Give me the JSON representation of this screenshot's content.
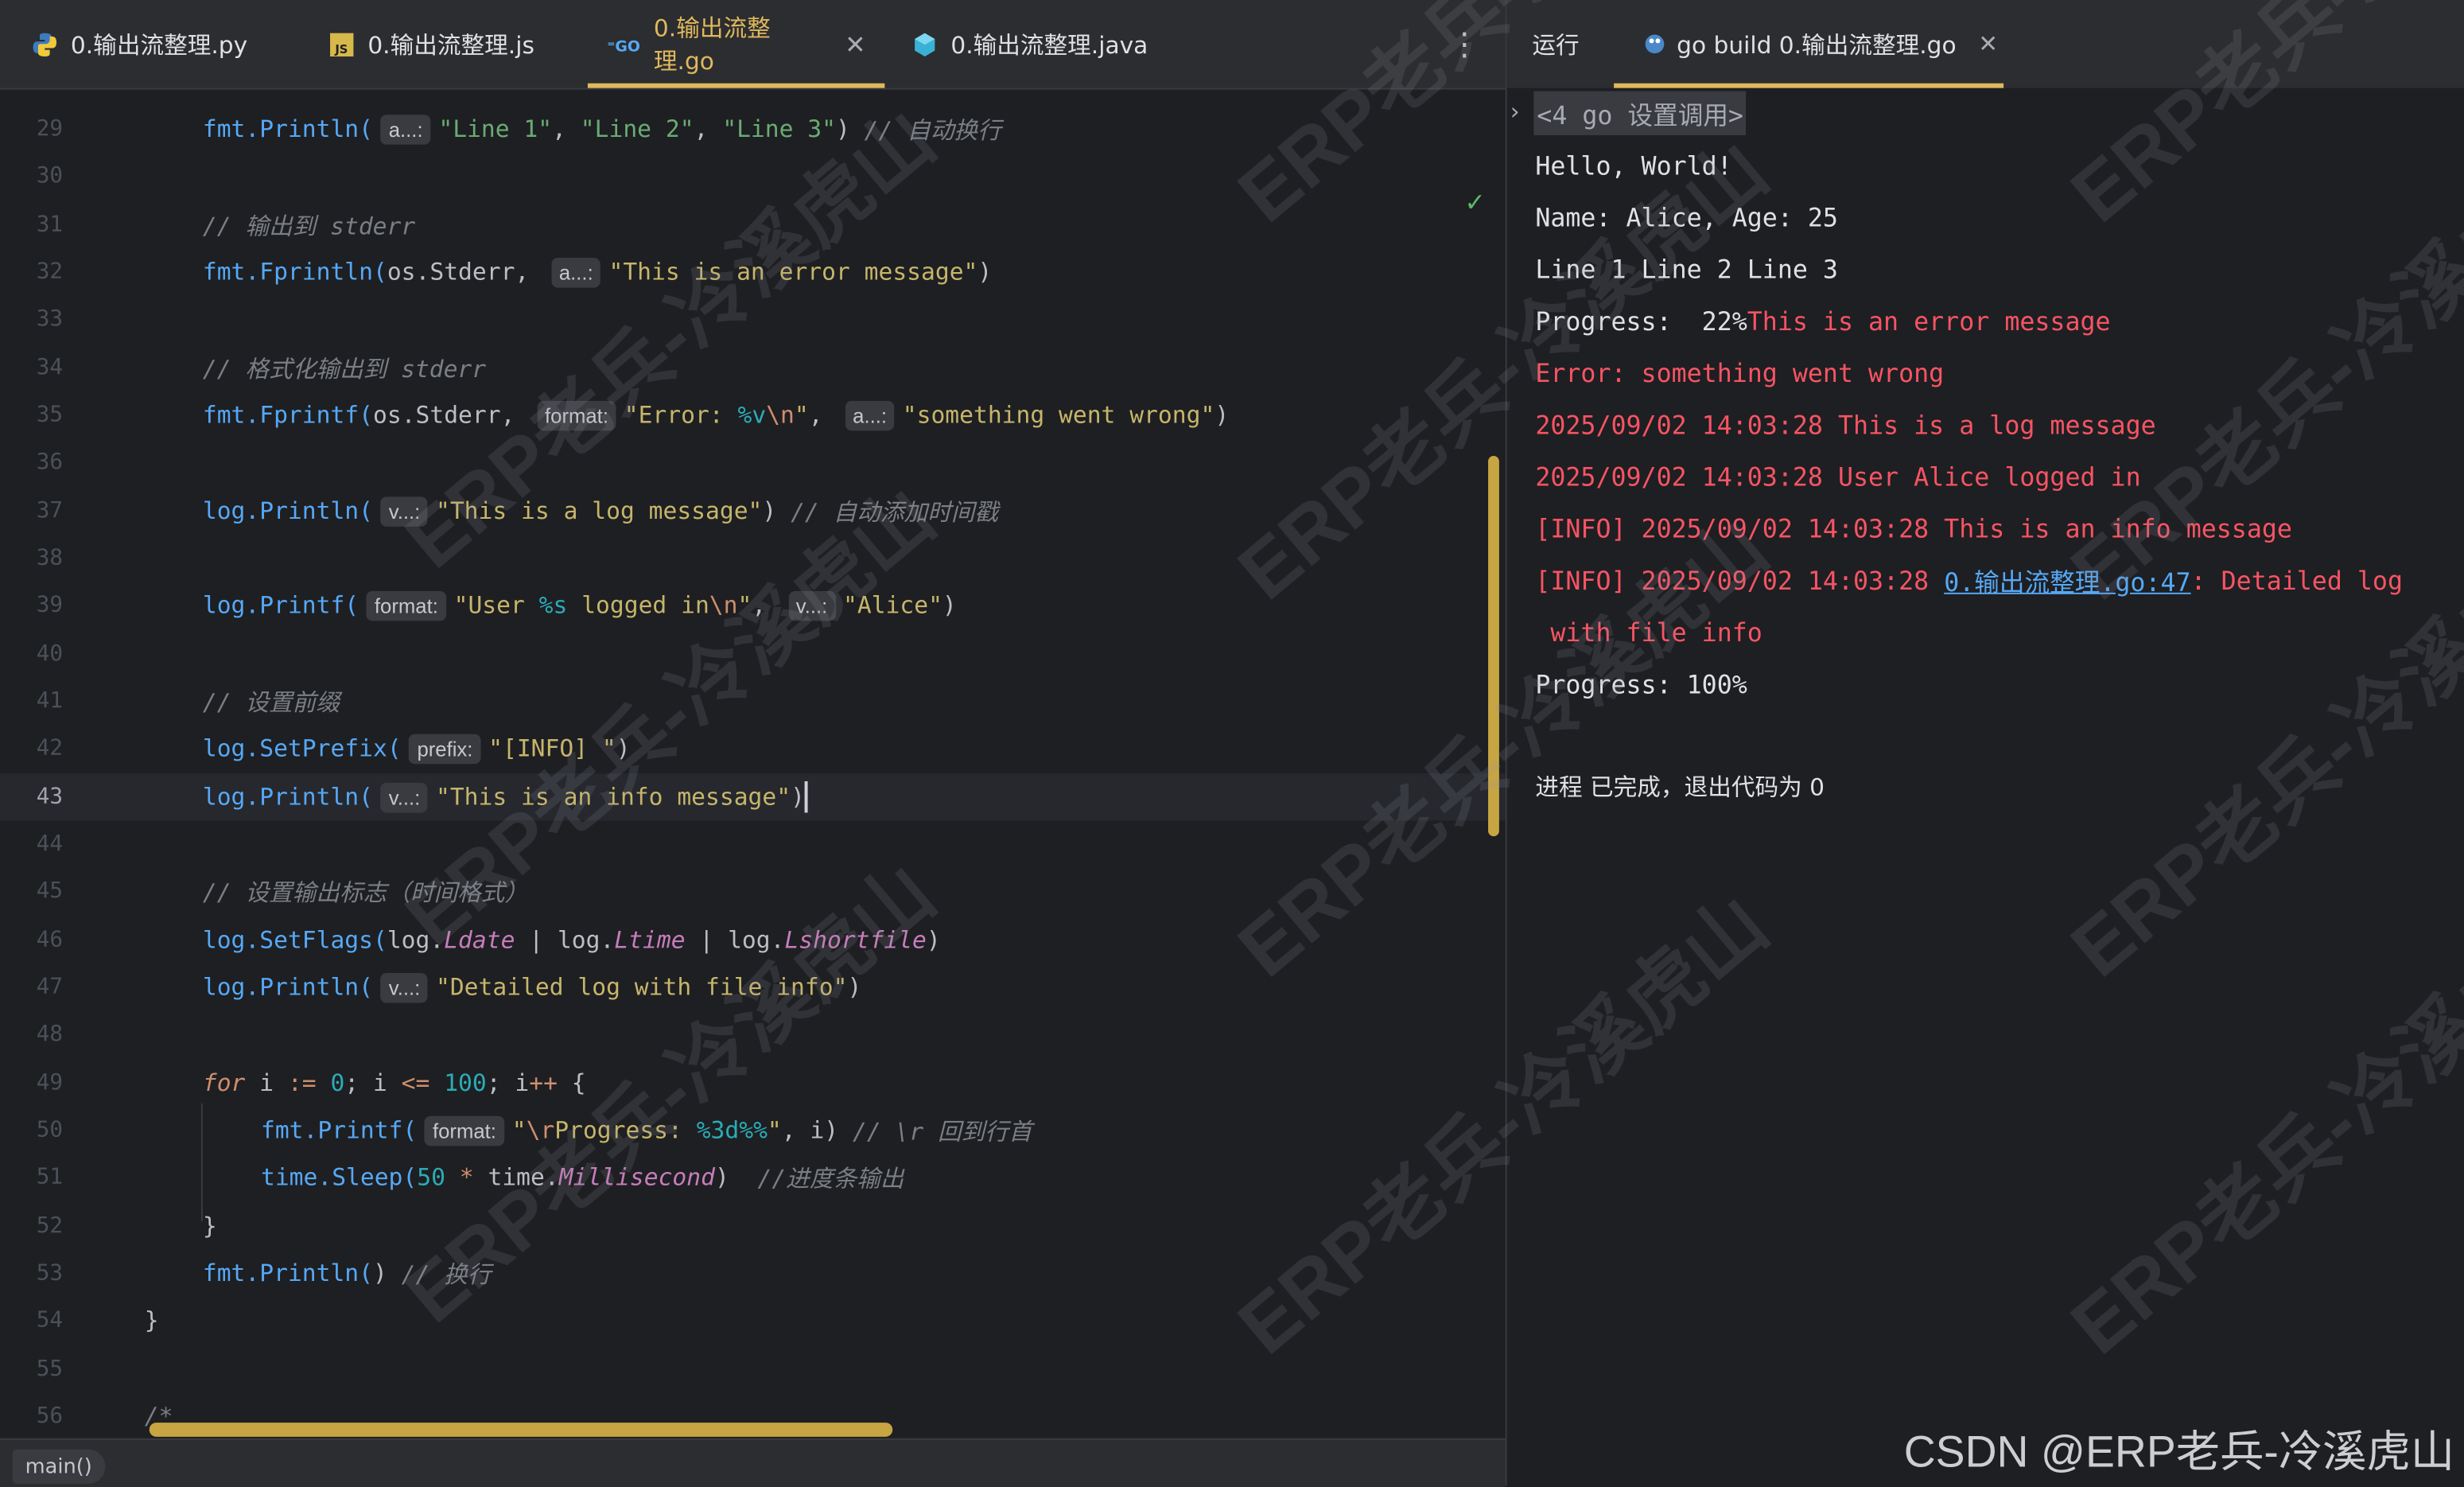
{
  "tabs": [
    {
      "name": "tab-python-file",
      "label": "0.输出流整理.py",
      "icon": "python-icon",
      "active": false
    },
    {
      "name": "tab-js-file",
      "label": "0.输出流整理.js",
      "icon": "javascript-icon",
      "active": false
    },
    {
      "name": "tab-go-file",
      "label": "0.输出流整理.go",
      "icon": "go-icon",
      "active": true
    },
    {
      "name": "tab-java-file",
      "label": "0.输出流整理.java",
      "icon": "java-icon",
      "active": false
    }
  ],
  "editor": {
    "lines": [
      {
        "n": "29",
        "text": "fmt.Println(  a...:  \"Line 1\", \"Line 2\", \"Line 3\") // 自动换行"
      },
      {
        "n": "30"
      },
      {
        "n": "31",
        "text": "// 输出到 stderr"
      },
      {
        "n": "32",
        "text": "fmt.Fprintln(os.Stderr,  a...:  \"This is an error message\")"
      },
      {
        "n": "33"
      },
      {
        "n": "34",
        "text": "// 格式化输出到 stderr"
      },
      {
        "n": "35",
        "text": "fmt.Fprintf(os.Stderr,  format:  \"Error: %v\\n\",  a...:  \"something went wrong\")"
      },
      {
        "n": "36"
      },
      {
        "n": "37",
        "text": "log.Println(  v...:  \"This is a log message\") // 自动添加时间戳"
      },
      {
        "n": "38"
      },
      {
        "n": "39",
        "text": "log.Printf(  format:  \"User %s logged in\\n\",  v...:  \"Alice\")"
      },
      {
        "n": "40"
      },
      {
        "n": "41",
        "text": "// 设置前缀"
      },
      {
        "n": "42",
        "text": "log.SetPrefix(  prefix:  \"[INFO] \")"
      },
      {
        "n": "43",
        "text": "log.Println(  v...:  \"This is an info message\")"
      },
      {
        "n": "44"
      },
      {
        "n": "45",
        "text": "// 设置输出标志（时间格式）"
      },
      {
        "n": "46",
        "text": "log.SetFlags(log.Ldate | log.Ltime | log.Lshortfile)"
      },
      {
        "n": "47",
        "text": "log.Println(  v...:  \"Detailed log with file info\")"
      },
      {
        "n": "48"
      },
      {
        "n": "49",
        "text": "for i := 0; i <= 100; i++ {"
      },
      {
        "n": "50",
        "text": "fmt.Printf(  format:  \"\\rProgress: %3d%%\", i) // \\r 回到行首"
      },
      {
        "n": "51",
        "text": "time.Sleep(50 * time.Millisecond)  //进度条输出"
      },
      {
        "n": "52",
        "text": "}"
      },
      {
        "n": "53",
        "text": "fmt.Println() // 换行"
      },
      {
        "n": "54",
        "text": "}"
      },
      {
        "n": "55"
      },
      {
        "n": "56",
        "text": "/*"
      }
    ],
    "breadcrumb": "main()"
  },
  "run": {
    "label": "运行",
    "tab_label": "go build 0.输出流整理.go",
    "output": [
      {
        "text": "<4 go 设置调用>",
        "kind": "cmd"
      },
      {
        "text": "Hello, World!",
        "kind": "out"
      },
      {
        "text": "Name: Alice, Age: 25",
        "kind": "out"
      },
      {
        "text": "Line 1 Line 2 Line 3",
        "kind": "out"
      },
      {
        "text": "Progress:  22%",
        "kind": "out",
        "tail": "This is an error message"
      },
      {
        "text": "Error: something went wrong",
        "kind": "err"
      },
      {
        "text": "2025/09/02 14:03:28 This is a log message",
        "kind": "err"
      },
      {
        "text": "2025/09/02 14:03:28 User Alice logged in",
        "kind": "err"
      },
      {
        "text": "[INFO] 2025/09/02 14:03:28 This is an info message",
        "kind": "err"
      },
      {
        "text": "[INFO] 2025/09/02 14:03:28 ",
        "kind": "err",
        "link": "0.输出流整理.go:47",
        "tail": ": Detailed log"
      },
      {
        "text": " with file info",
        "kind": "err"
      },
      {
        "text": "Progress: 100%",
        "kind": "out"
      },
      {
        "text": "进程 已完成，退出代码为 0",
        "kind": "done"
      }
    ]
  },
  "watermark": "ERP老兵-冷溪虎山",
  "footer_watermark": "CSDN @ERP老兵-冷溪虎山"
}
